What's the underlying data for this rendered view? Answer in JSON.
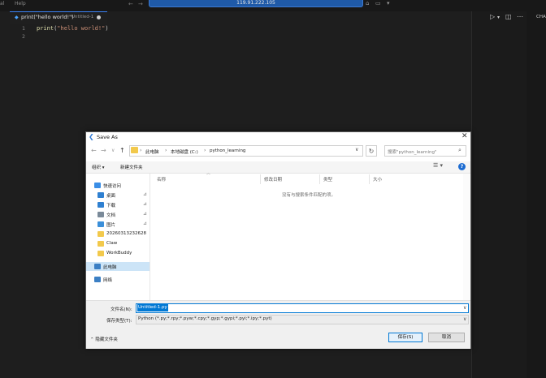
{
  "menu": [
    "al",
    "Help"
  ],
  "remote": {
    "address": "119.91.222.105"
  },
  "editor": {
    "tab_title": "print(\"hello world!\")",
    "tab_subtitle": "Untitled-1",
    "line_numbers": [
      "1",
      "2"
    ],
    "code_fn": "print",
    "code_open": "(",
    "code_str": "\"hello world!\"",
    "code_close": ")"
  },
  "right": {
    "chat_label": "CHA"
  },
  "dialog": {
    "title": "Save As",
    "breadcrumb": [
      "此电脑",
      "本地磁盘 (C:)",
      "python_learning"
    ],
    "search_placeholder": "搜索\"python_learning\"",
    "toolbar": {
      "organize": "组织 ▾",
      "new_folder": "新建文件夹"
    },
    "nav": [
      {
        "label": "快速访问",
        "icon": "star-icon",
        "color": "#3a8ee6",
        "pinned": false
      },
      {
        "label": "桌面",
        "icon": "desktop-icon",
        "color": "#2f80d1",
        "pinned": true
      },
      {
        "label": "下载",
        "icon": "download-icon",
        "color": "#2f80d1",
        "pinned": true
      },
      {
        "label": "文档",
        "icon": "documents-icon",
        "color": "#7a8a99",
        "pinned": true
      },
      {
        "label": "图片",
        "icon": "pictures-icon",
        "color": "#3b8fd9",
        "pinned": true
      },
      {
        "label": "20260313232628",
        "icon": "folder-icon",
        "color": "#f2c94c",
        "pinned": false
      },
      {
        "label": "Claw",
        "icon": "folder-icon",
        "color": "#f2c94c",
        "pinned": false
      },
      {
        "label": "WorkBuddy",
        "icon": "folder-icon",
        "color": "#f2c94c",
        "pinned": false
      },
      {
        "label": "此电脑",
        "icon": "this-pc-icon",
        "color": "#3b7fc4",
        "pinned": false
      },
      {
        "label": "网络",
        "icon": "network-icon",
        "color": "#3b7fc4",
        "pinned": false
      }
    ],
    "columns": [
      "名称",
      "修改日期",
      "类型",
      "大小"
    ],
    "empty_message": "没有与搜索条件匹配的项。",
    "filename_label": "文件名(N):",
    "filename_value": "Untitled-1.py",
    "filetype_label": "保存类型(T):",
    "filetype_value": "Python (*.py;*.rpy;*.pyw;*.cpy;*.gyp;*.gypi;*.pyi;*.ipy;*.pyt)",
    "hide_folders": "隐藏文件夹",
    "save_button": "保存(S)",
    "cancel_button": "取消"
  }
}
